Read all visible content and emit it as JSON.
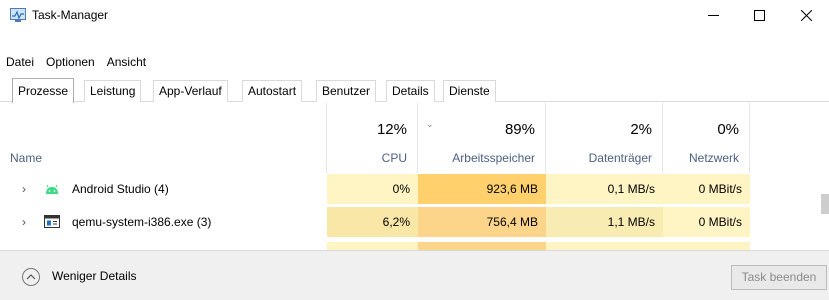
{
  "window": {
    "title": "Task-Manager",
    "minimize_icon": "minimize-icon",
    "maximize_icon": "maximize-icon",
    "close_icon": "close-icon"
  },
  "menu": [
    "Datei",
    "Optionen",
    "Ansicht"
  ],
  "tabs": [
    "Prozesse",
    "Leistung",
    "App-Verlauf",
    "Autostart",
    "Benutzer",
    "Details",
    "Dienste"
  ],
  "active_tab": "Prozesse",
  "columns": {
    "name": {
      "label": "Name"
    },
    "cpu": {
      "percent": "12%",
      "label": "CPU"
    },
    "memory": {
      "percent": "89%",
      "label": "Arbeitsspeicher"
    },
    "disk": {
      "percent": "2%",
      "label": "Datenträger"
    },
    "network": {
      "percent": "0%",
      "label": "Netzwerk"
    }
  },
  "processes": [
    {
      "name": "Android Studio (4)",
      "icon": "android-icon",
      "cpu": "0%",
      "memory": "923,6 MB",
      "disk": "0,1 MB/s",
      "network": "0 MBit/s"
    },
    {
      "name": "qemu-system-i386.exe (3)",
      "icon": "application-window-icon",
      "cpu": "6,2%",
      "memory": "756,4 MB",
      "disk": "1,1 MB/s",
      "network": "0 MBit/s"
    }
  ],
  "footer": {
    "less_details": "Weniger Details",
    "end_task": "Task beenden"
  },
  "colors": {
    "heat_light": "#fff4c4",
    "heat_medium": "#f9ecb3",
    "heat_memory_high": "#ffd06b",
    "heat_memory_mid": "#fdd58a",
    "header_label": "#4d6082"
  }
}
